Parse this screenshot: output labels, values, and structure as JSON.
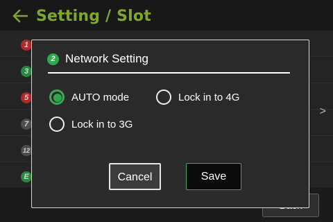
{
  "header": {
    "title": "Setting / Slot"
  },
  "list": {
    "items": [
      {
        "badge": "1",
        "badge_color": "red"
      },
      {
        "badge": "3",
        "badge_color": "green"
      },
      {
        "badge": "5",
        "badge_color": "red"
      },
      {
        "badge": "7",
        "badge_color": "gray"
      },
      {
        "badge": "12",
        "badge_color": "gray"
      },
      {
        "badge": "E",
        "badge_color": "green"
      }
    ],
    "row_arrow": ">"
  },
  "footer": {
    "back_label": "Back"
  },
  "dialog": {
    "badge": "2",
    "title": "Network Setting",
    "options": [
      {
        "label": "AUTO mode",
        "selected": true
      },
      {
        "label": "Lock in to 4G",
        "selected": false
      },
      {
        "label": "Lock in to 3G",
        "selected": false
      }
    ],
    "cancel_label": "Cancel",
    "save_label": "Save"
  },
  "colors": {
    "accent": "#9ccb3b",
    "selected": "#2fa84f",
    "badge_red": "#d93232",
    "badge_gray": "#5e5e5e"
  },
  "icons": {
    "back": "left-arrow-icon",
    "row_chevron": "chevron-right-icon"
  }
}
